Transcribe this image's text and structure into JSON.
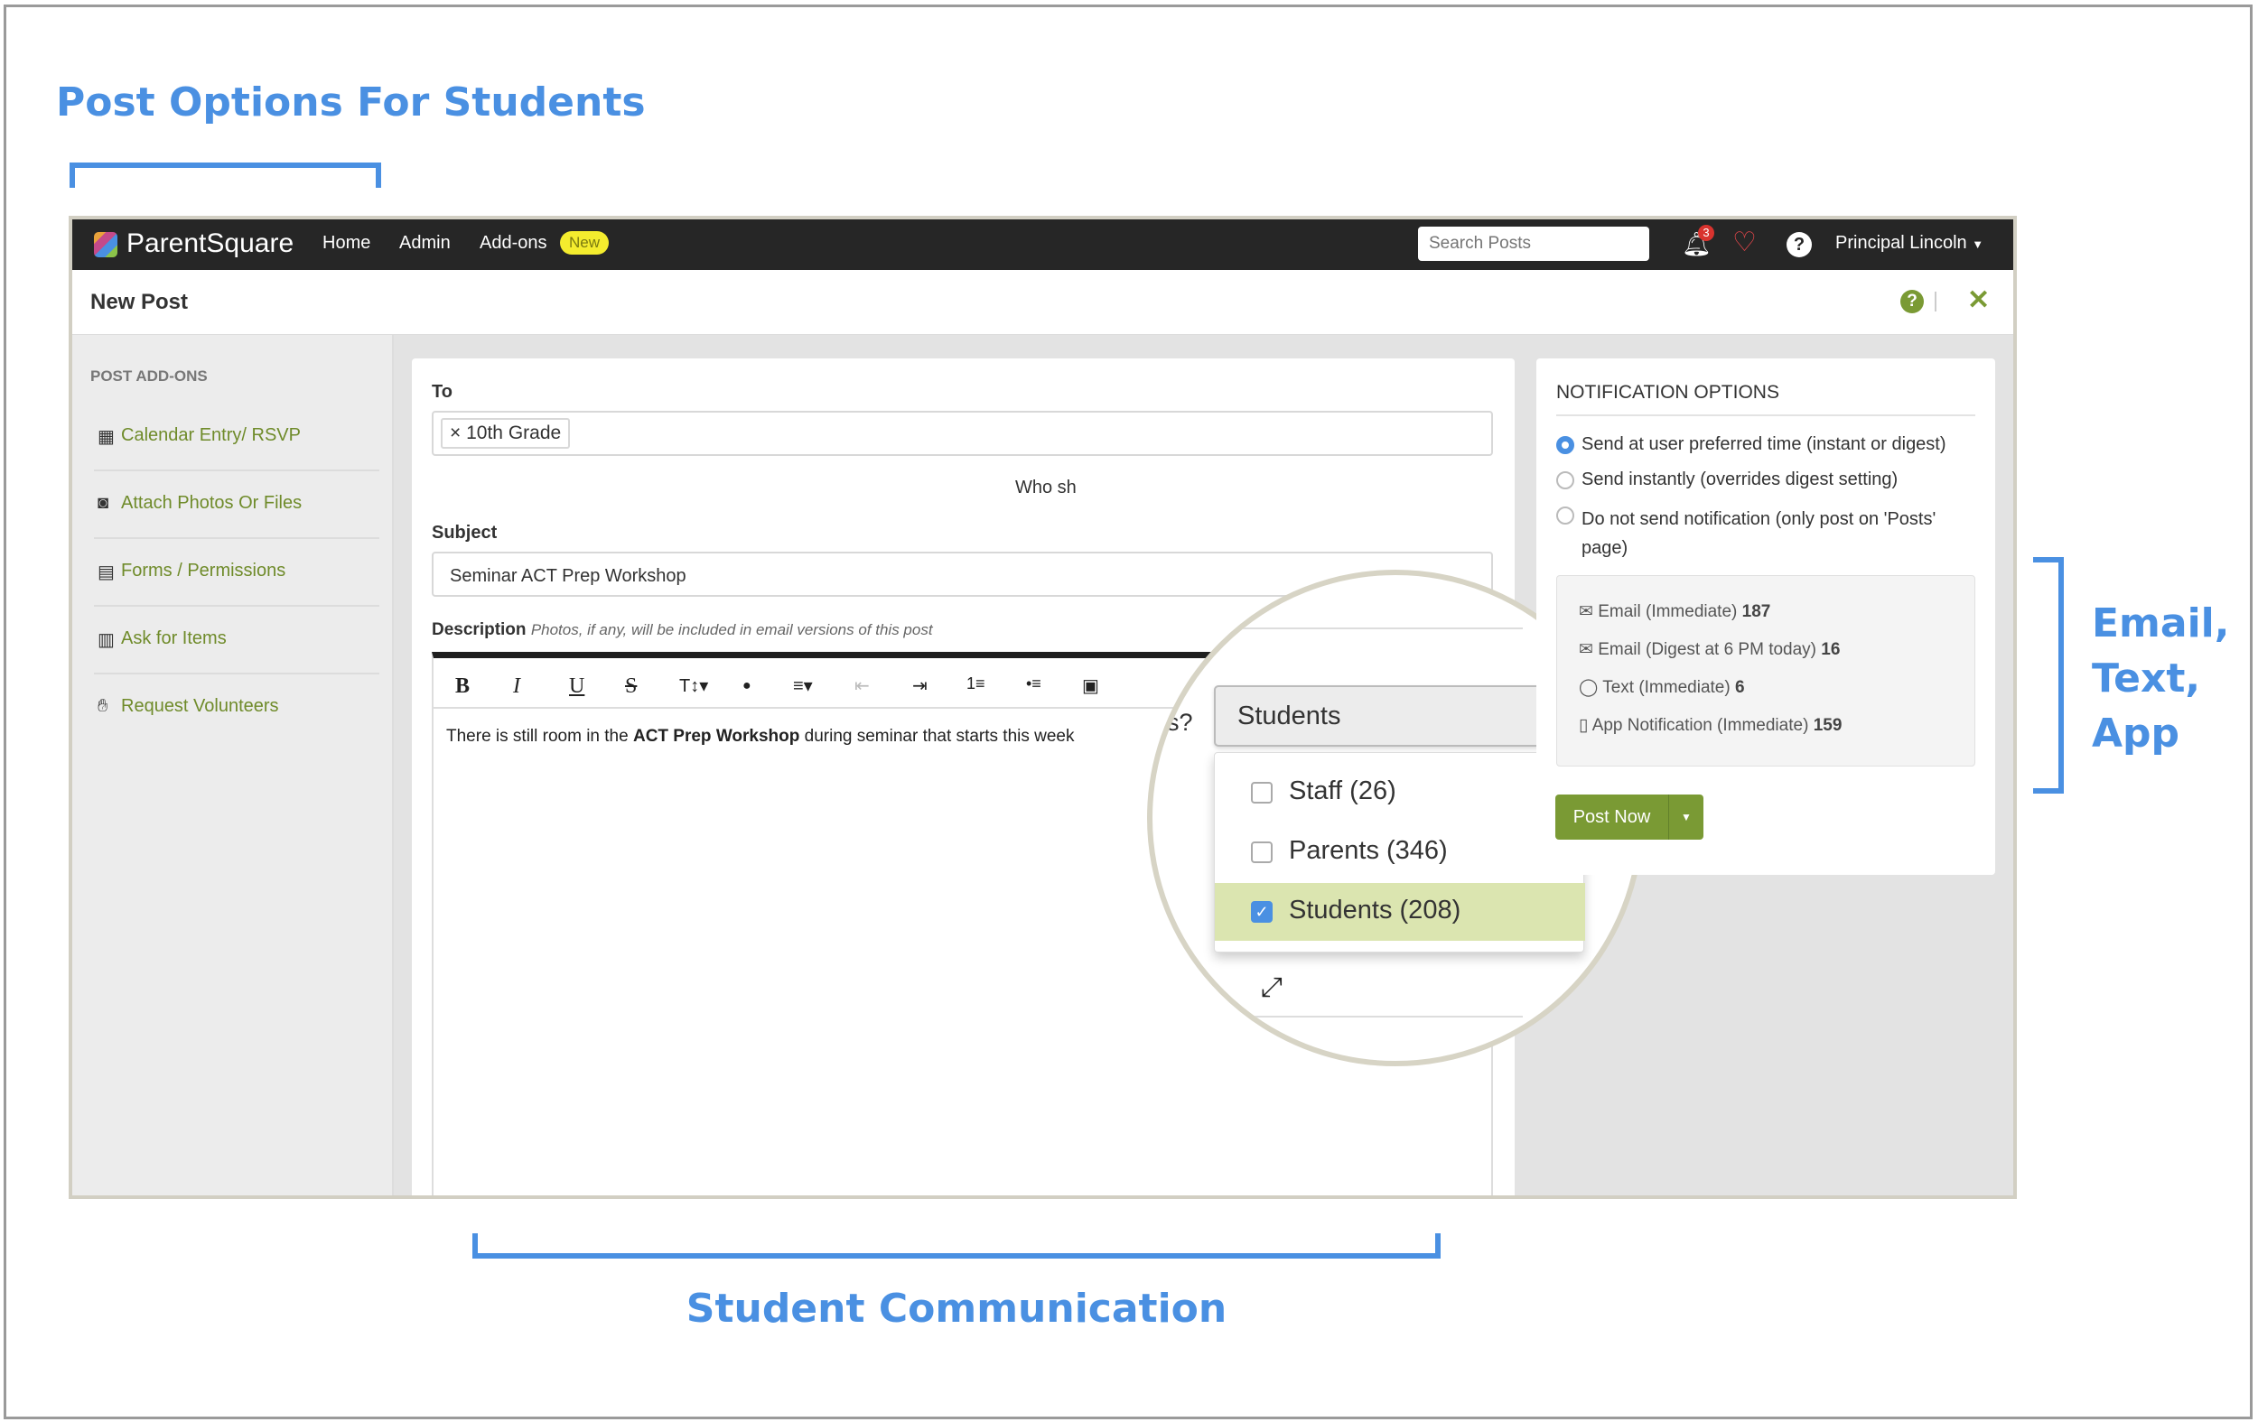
{
  "annotations": {
    "top_title": "Post Options For Students",
    "bottom_title": "Student Communication",
    "right_lines": [
      "Email,",
      "Text,",
      "App"
    ]
  },
  "colors": {
    "annotation": "#4a90e2",
    "brand_green": "#7a9a34",
    "navbar": "#262626",
    "highlight": "#dbe5b0"
  },
  "navbar": {
    "logo": "ParentSquare",
    "items": [
      "Home",
      "Admin",
      "Add-ons"
    ],
    "badge": "New",
    "search_placeholder": "Search Posts",
    "notification_count": "3",
    "user": "Principal Lincoln"
  },
  "header": {
    "title": "New Post"
  },
  "sidebar": {
    "heading": "POST ADD-ONS",
    "items": [
      {
        "icon": "calendar-icon",
        "label": "Calendar Entry/ RSVP"
      },
      {
        "icon": "camera-icon",
        "label": "Attach Photos Or Files"
      },
      {
        "icon": "document-icon",
        "label": "Forms / Permissions"
      },
      {
        "icon": "basket-icon",
        "label": "Ask for Items"
      },
      {
        "icon": "hand-icon",
        "label": "Request Volunteers"
      }
    ]
  },
  "form": {
    "to_label": "To",
    "to_chip": "10th Grade",
    "who_label": "Who sh",
    "who_label_magnified": "s?",
    "subject_label": "Subject",
    "subject_value": "Seminar ACT Prep Workshop",
    "description_label": "Description",
    "description_hint": "Photos, if any, will be included in email versions of this post",
    "body_pre": "There is still room in the ",
    "body_bold": "ACT Prep Workshop",
    "body_post": " during seminar that starts this week"
  },
  "toolbar": [
    "B",
    "I",
    "U",
    "S",
    "T↕▾",
    "●",
    "≡▾",
    "⇤",
    "⇥",
    "1≡",
    "•≡",
    "▣"
  ],
  "dropdown": {
    "selected": "Students",
    "options": [
      {
        "label": "Staff (26)",
        "checked": false
      },
      {
        "label": "Parents (346)",
        "checked": false
      },
      {
        "label": "Students (208)",
        "checked": true
      }
    ]
  },
  "notifications": {
    "title": "NOTIFICATION OPTIONS",
    "options": [
      {
        "label": "Send at user preferred time (instant or digest)",
        "selected": true
      },
      {
        "label": "Send instantly (overrides digest setting)",
        "selected": false
      },
      {
        "label": "Do not send notification (only post on 'Posts' page)",
        "selected": false
      }
    ],
    "counts": [
      {
        "icon": "envelope-icon",
        "label": "Email (Immediate)",
        "value": "187"
      },
      {
        "icon": "envelope-icon",
        "label": "Email (Digest at 6 PM today)",
        "value": "16"
      },
      {
        "icon": "chat-bubble-icon",
        "label": "Text (Immediate)",
        "value": "6"
      },
      {
        "icon": "phone-icon",
        "label": "App Notification (Immediate)",
        "value": "159"
      }
    ],
    "post_button": "Post Now"
  }
}
